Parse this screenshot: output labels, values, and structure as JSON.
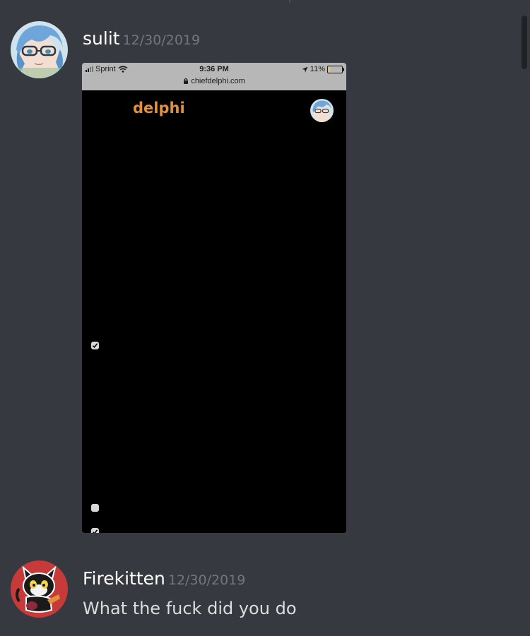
{
  "messages": [
    {
      "author": "sulit",
      "timestamp": "12/30/2019",
      "attachment": {
        "status_bar": {
          "carrier": "Sprint",
          "time": "9:36 PM",
          "url": "chiefdelphi.com",
          "battery": "11%",
          "battery_level": 0.11
        },
        "site_logo": "delphi",
        "checkboxes": [
          {
            "checked": true
          },
          {
            "checked": false
          },
          {
            "checked": true
          }
        ]
      }
    },
    {
      "author": "Firekitten",
      "timestamp": "12/30/2019",
      "content": "What the fuck did you do"
    }
  ],
  "colors": {
    "background": "#36393f",
    "author": "#ffffff",
    "timestamp": "#72767d",
    "content": "#dcddde",
    "logo": "#e0913a"
  }
}
